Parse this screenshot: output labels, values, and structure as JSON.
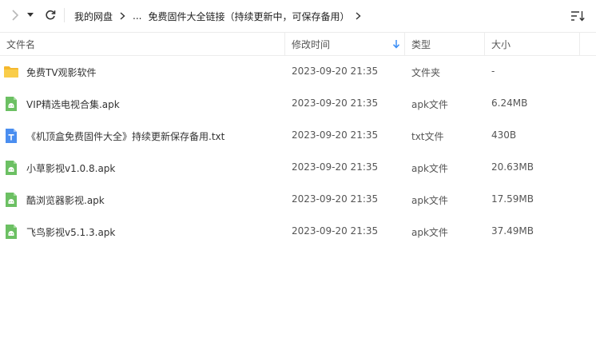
{
  "toolbar": {
    "breadcrumb": {
      "root": "我的网盘",
      "ellipsis": "...",
      "current": "免费固件大全链接（持续更新中，可保存备用）"
    }
  },
  "columns": {
    "name": "文件名",
    "date": "修改时间",
    "type": "类型",
    "size": "大小"
  },
  "files": [
    {
      "name": "免费TV观影软件",
      "date": "2023-09-20 21:35",
      "type": "文件夹",
      "size": "-",
      "icon": "folder-icon"
    },
    {
      "name": "VIP精选电视合集.apk",
      "date": "2023-09-20 21:35",
      "type": "apk文件",
      "size": "6.24MB",
      "icon": "apk-file-icon"
    },
    {
      "name": "《机顶盒免费固件大全》持续更新保存备用.txt",
      "date": "2023-09-20 21:35",
      "type": "txt文件",
      "size": "430B",
      "icon": "text-file-icon"
    },
    {
      "name": "小草影视v1.0.8.apk",
      "date": "2023-09-20 21:35",
      "type": "apk文件",
      "size": "20.63MB",
      "icon": "apk-file-icon"
    },
    {
      "name": "酷浏览器影视.apk",
      "date": "2023-09-20 21:35",
      "type": "apk文件",
      "size": "17.59MB",
      "icon": "apk-file-icon"
    },
    {
      "name": "飞鸟影视v5.1.3.apk",
      "date": "2023-09-20 21:35",
      "type": "apk文件",
      "size": "37.49MB",
      "icon": "apk-file-icon"
    }
  ],
  "colors": {
    "accent": "#3a8ef6",
    "folder": "#f8c33a",
    "apk": "#6cc063",
    "txt": "#4a8ef0"
  }
}
